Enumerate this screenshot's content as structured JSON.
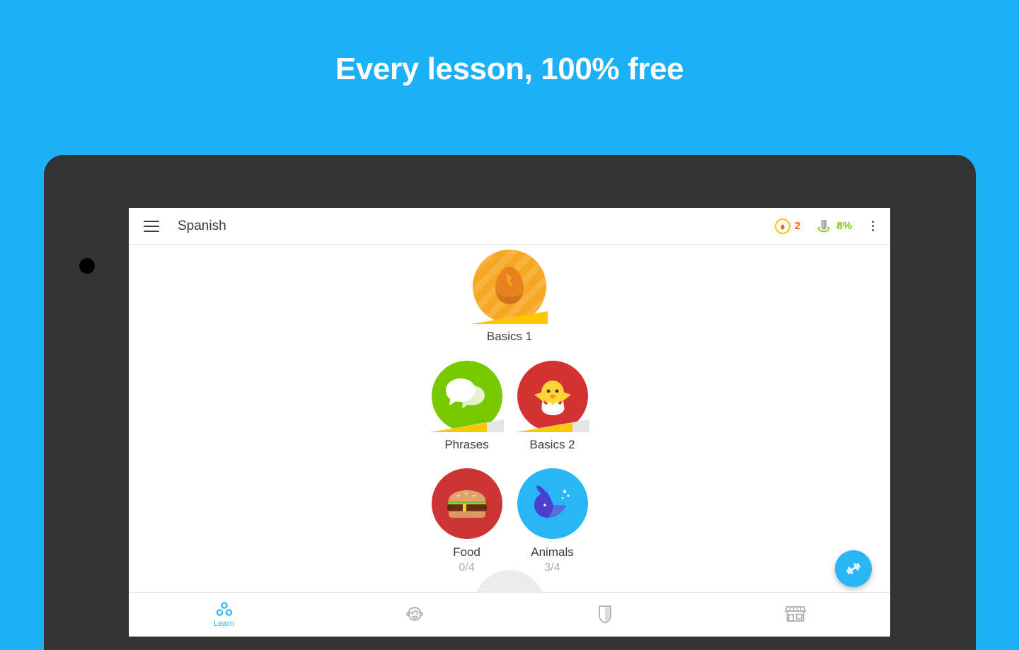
{
  "promo": {
    "headline": "Every lesson, 100% free",
    "background_color": "#1CB0F6"
  },
  "device": {
    "frame_color": "#333333",
    "camera_icon": "camera-dot"
  },
  "appbar": {
    "menu_icon": "hamburger-menu-icon",
    "title": "Spanish",
    "streak": {
      "icon": "flame-icon",
      "count": "2",
      "color": "#F2620F"
    },
    "progress": {
      "icon": "shield-laurel-icon",
      "value": "8%",
      "color": "#78C800"
    },
    "overflow_icon": "more-vertical-icon"
  },
  "tree": {
    "rows": [
      {
        "skills": [
          {
            "name": "Basics 1",
            "icon": "cracked-egg-icon",
            "color": "#F5A623",
            "glyph_color": "#E8821E",
            "progress": "full",
            "sub": "",
            "striped": true
          }
        ]
      },
      {
        "skills": [
          {
            "name": "Phrases",
            "icon": "speech-bubbles-icon",
            "color": "#78C800",
            "glyph_color": "#FFFFFF",
            "progress": "partial",
            "sub": "",
            "striped": false
          },
          {
            "name": "Basics 2",
            "icon": "hatching-chick-icon",
            "color": "#D33232",
            "glyph_color": "#FFCC1A",
            "progress": "partial",
            "sub": "",
            "striped": false
          }
        ]
      },
      {
        "skills": [
          {
            "name": "Food",
            "icon": "hamburger-food-icon",
            "color": "#CE3434",
            "glyph_color": "#E8A06A",
            "progress": "none",
            "sub": "0/4",
            "striped": false
          },
          {
            "name": "Animals",
            "icon": "whale-icon",
            "color": "#29B6F6",
            "glyph_color": "#4B3FD0",
            "progress": "none",
            "sub": "3/4",
            "striped": false
          }
        ]
      }
    ],
    "locked_skill_icon": "locked-skill-circle"
  },
  "fab": {
    "icon": "dumbbell-icon",
    "color": "#29B6F6"
  },
  "bottomnav": {
    "items": [
      {
        "label": "Learn",
        "icon": "skill-tree-icon",
        "active": true
      },
      {
        "label": "",
        "icon": "profile-face-icon",
        "active": false
      },
      {
        "label": "",
        "icon": "shield-icon",
        "active": false
      },
      {
        "label": "",
        "icon": "shop-store-icon",
        "active": false
      }
    ],
    "active_color": "#1CB0F6",
    "inactive_color": "#AFAFAF"
  }
}
